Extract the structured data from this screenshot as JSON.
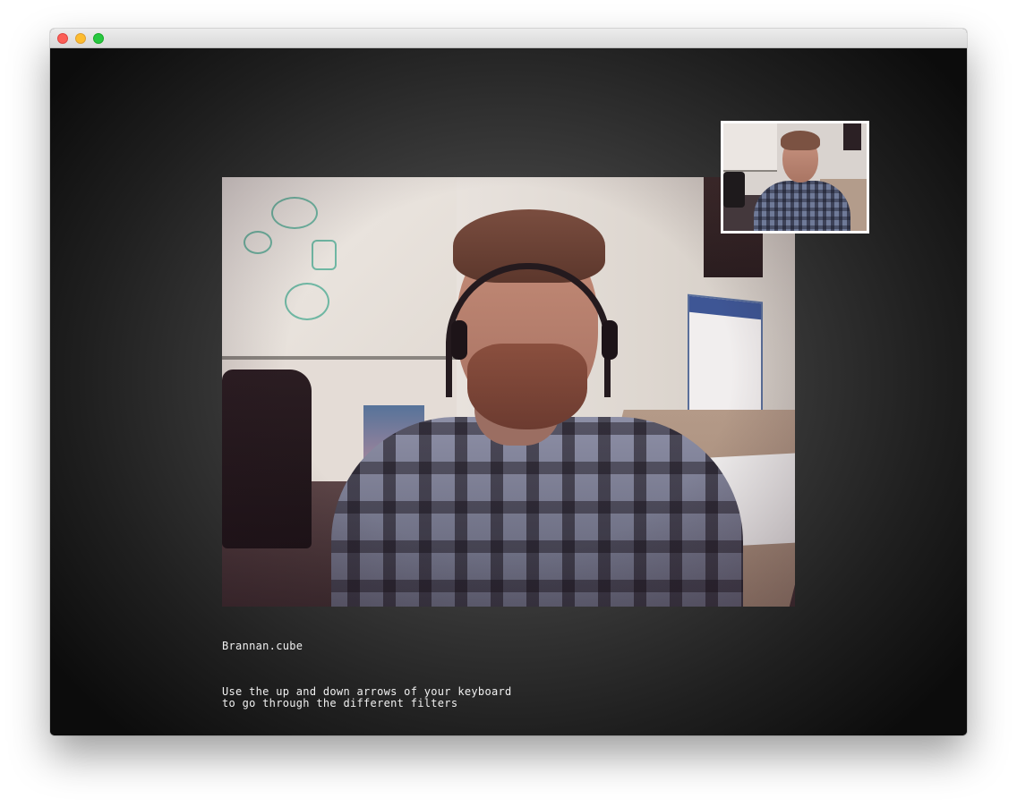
{
  "window": {
    "controls": [
      "close",
      "minimize",
      "zoom"
    ]
  },
  "video": {
    "description_icon": "camera-feed",
    "self_view_icon": "self-view-thumbnail"
  },
  "filter": {
    "current_name": "Brannan.cube"
  },
  "instructions": {
    "line1": "Use the up and down arrows of your keyboard",
    "line2": "to go through the different filters"
  }
}
